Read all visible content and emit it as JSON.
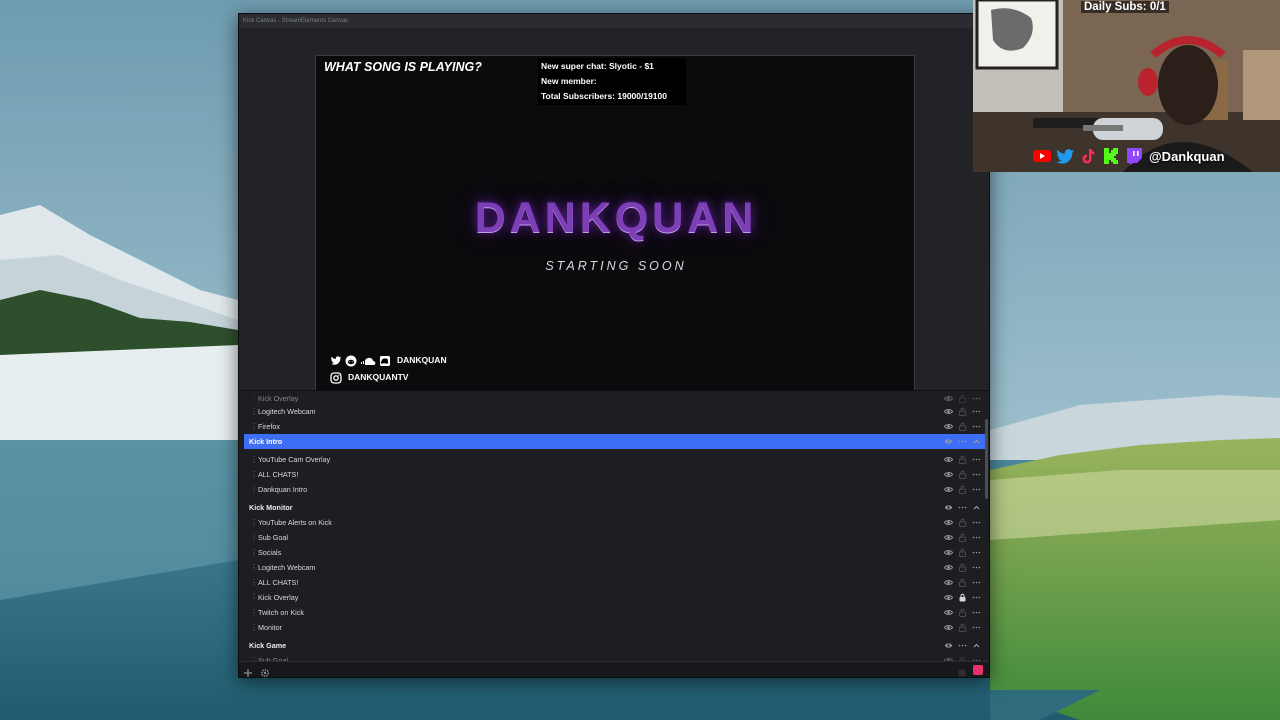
{
  "window": {
    "title": "Kick Canvas - StreamElements Canvas"
  },
  "preview": {
    "song_question": "WHAT SONG IS PLAYING?",
    "alerts": [
      "New super chat: Slyotic - $1",
      "New member:",
      "Total Subscribers: 19000/19100"
    ],
    "title": "DANKQUAN",
    "subtitle": "STARTING SOON",
    "socials": [
      {
        "icons": [
          "twitter-icon",
          "reddit-icon",
          "soundcloud-icon",
          "discord-icon"
        ],
        "handle": "DANKQUAN"
      },
      {
        "icons": [
          "instagram-icon"
        ],
        "handle": "DANKQUANTV"
      }
    ],
    "title_color": "#7d3fb6"
  },
  "layers": {
    "rows": [
      {
        "label": "Kick Overlay",
        "kind": "item",
        "clipped": true
      },
      {
        "label": "Logitech Webcam",
        "kind": "item"
      },
      {
        "label": "Firefox",
        "kind": "item"
      },
      {
        "label": "Kick Intro",
        "kind": "group",
        "selected": true
      },
      {
        "label": "YouTube Cam Overlay",
        "kind": "item"
      },
      {
        "label": "ALL CHATS!",
        "kind": "item"
      },
      {
        "label": "Dankquan Intro",
        "kind": "item"
      },
      {
        "label": "Kick Monitor",
        "kind": "group"
      },
      {
        "label": "YouTube Alerts on Kick",
        "kind": "item"
      },
      {
        "label": "Sub Goal",
        "kind": "item"
      },
      {
        "label": "Socials",
        "kind": "item"
      },
      {
        "label": "Logitech Webcam",
        "kind": "item"
      },
      {
        "label": "ALL CHATS!",
        "kind": "item"
      },
      {
        "label": "Kick Overlay",
        "kind": "item",
        "locked": true
      },
      {
        "label": "Twitch on Kick",
        "kind": "item"
      },
      {
        "label": "Monitor",
        "kind": "item"
      },
      {
        "label": "Kick Game",
        "kind": "group"
      },
      {
        "label": "Sub Goal",
        "kind": "item",
        "clipped": true
      }
    ],
    "selected_color": "#3f6ef6"
  },
  "toolbar": {
    "icons": [
      "add-icon",
      "gear-icon",
      "stop-icon",
      "record-icon"
    ],
    "record_color": "#e5326b"
  },
  "webcam": {
    "daily_subs": "Daily Subs: 0/1",
    "social_icons": [
      "youtube-icon",
      "twitter-icon",
      "tiktok-icon",
      "kick-icon",
      "twitch-icon"
    ],
    "handle": "@Dankquan"
  }
}
